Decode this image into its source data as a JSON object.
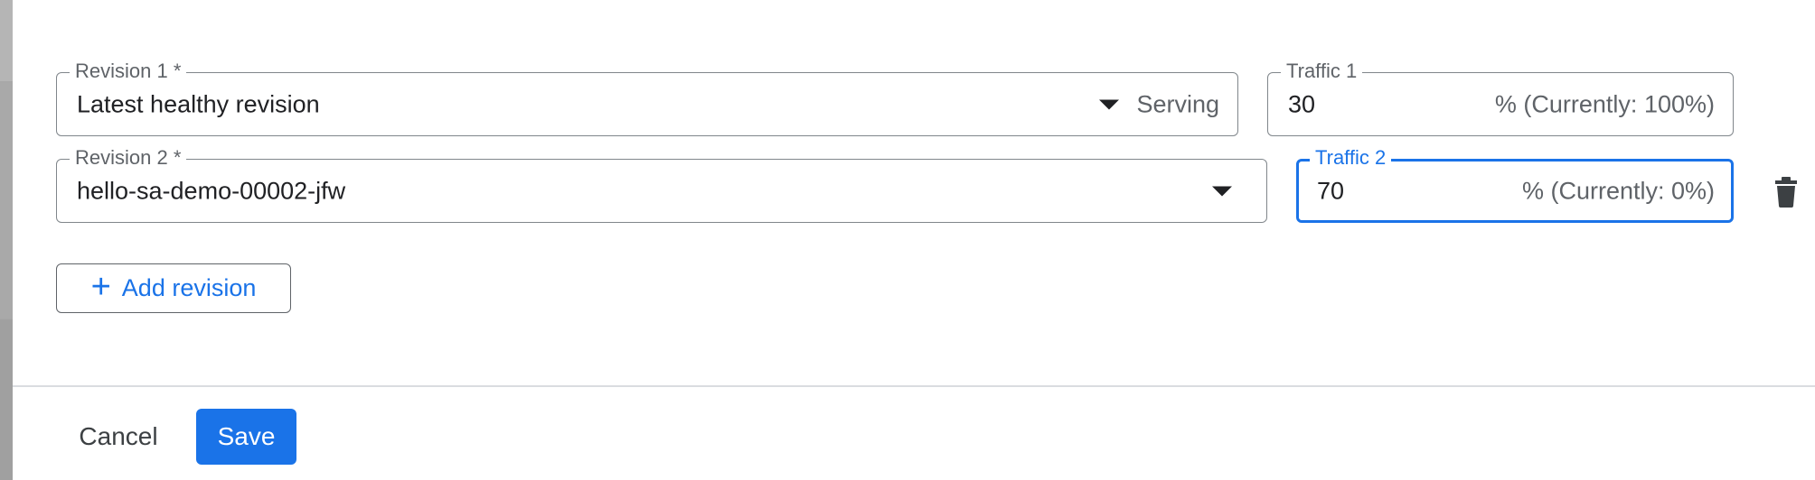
{
  "revisions": [
    {
      "label": "Revision 1 *",
      "value": "Latest healthy revision",
      "suffix": "Serving",
      "traffic_label": "Traffic 1",
      "traffic_value": "30",
      "traffic_suffix": "% (Currently: 100%)"
    },
    {
      "label": "Revision 2 *",
      "value": "hello-sa-demo-00002-jfw",
      "traffic_label": "Traffic 2",
      "traffic_value": "70",
      "traffic_suffix": "% (Currently: 0%)"
    }
  ],
  "add_revision": {
    "label": "Add revision",
    "icon": "plus-icon"
  },
  "delete_icon": "trash-icon",
  "footer": {
    "cancel_label": "Cancel",
    "save_label": "Save"
  },
  "colors": {
    "accent": "#1a73e8",
    "border": "#80868b",
    "text": "#202124",
    "muted": "#5f6368",
    "divider": "#dadce0"
  }
}
